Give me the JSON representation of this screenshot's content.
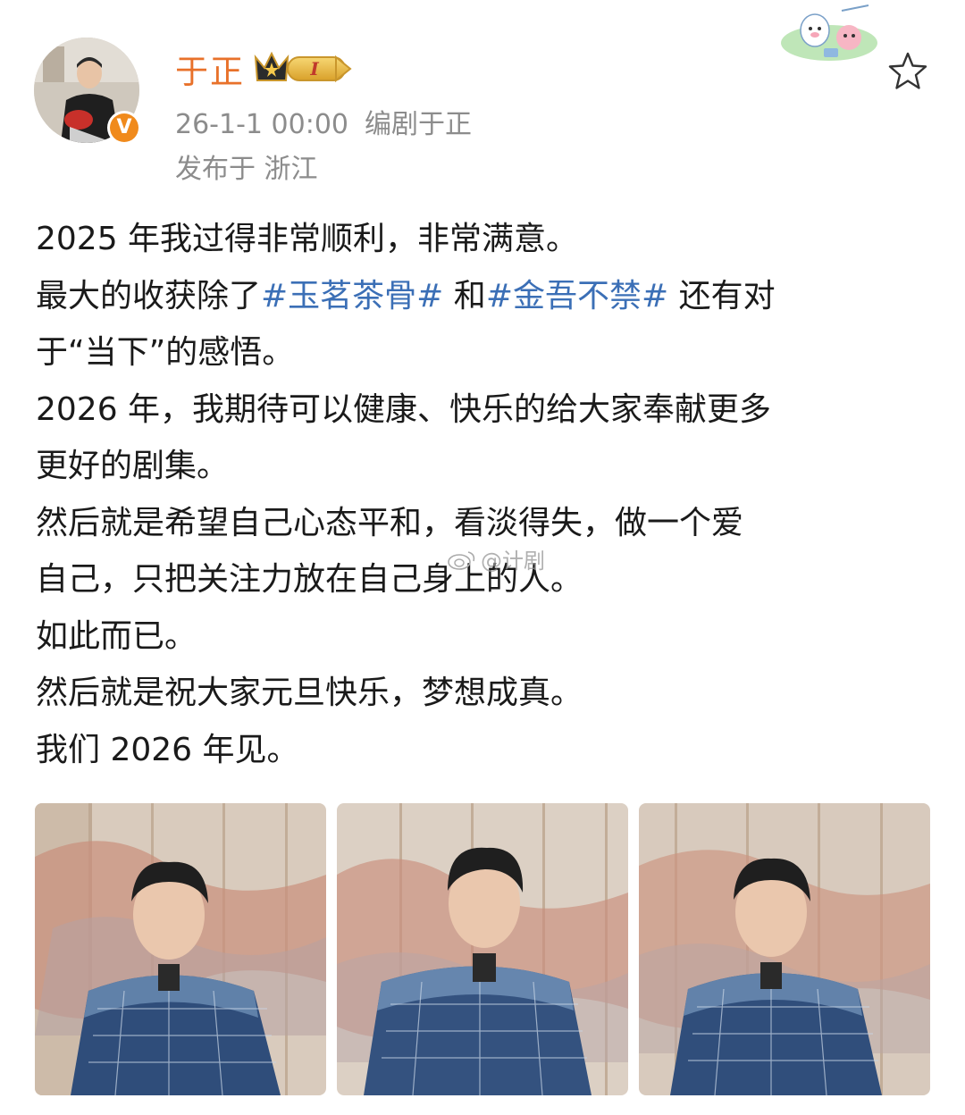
{
  "author": {
    "name": "于正",
    "verified_mark": "V",
    "level_badge": "I",
    "avatar_icon": "avatar-photo"
  },
  "meta": {
    "time": "26-1-1 00:00",
    "source": "编剧于正",
    "location": "发布于 浙江"
  },
  "post": {
    "line1": "2025 年我过得非常顺利，非常满意。",
    "line2_pre": "最大的收获除了",
    "topic1": "#玉茗茶骨#",
    "line2_mid": " 和",
    "topic2": "#金吾不禁#",
    "line2_post": " 还有对",
    "line3": "于“当下”的感悟。",
    "line4": "2026 年，我期待可以健康、快乐的给大家奉献更多",
    "line5": "更好的剧集。",
    "line6": "然后就是希望自己心态平和，看淡得失，做一个爱",
    "line7": "自己，只把关注力放在自己身上的人。",
    "line8": "如此而已。",
    "line9": "然后就是祝大家元旦快乐，梦想成真。",
    "line10": "我们 2026 年见。"
  },
  "watermark": "@计剧",
  "colors": {
    "author_name": "#e8712a",
    "topic_link": "#3b6fb6",
    "meta_text": "#8c8c8c",
    "body_text": "#1a1a1a"
  },
  "icons": [
    "star-outline-icon",
    "crown-level-badge",
    "verified-v-icon",
    "sticker-yeah"
  ],
  "photos": [
    {
      "alt": "photo-1"
    },
    {
      "alt": "photo-2"
    },
    {
      "alt": "photo-3"
    }
  ]
}
